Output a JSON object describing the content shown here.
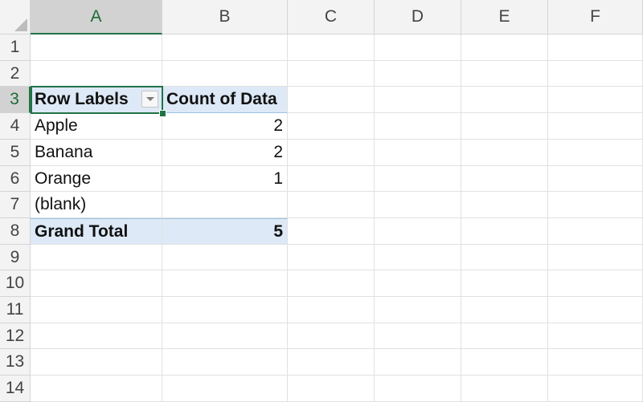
{
  "columns": [
    "A",
    "B",
    "C",
    "D",
    "E",
    "F"
  ],
  "rows": [
    "1",
    "2",
    "3",
    "4",
    "5",
    "6",
    "7",
    "8",
    "9",
    "10",
    "11",
    "12",
    "13",
    "14"
  ],
  "active_cell": "A3",
  "pivot": {
    "header": {
      "row_labels": "Row Labels",
      "value_label": "Count of Data"
    },
    "items": [
      {
        "label": "Apple",
        "count": "2"
      },
      {
        "label": "Banana",
        "count": "2"
      },
      {
        "label": "Orange",
        "count": "1"
      },
      {
        "label": "(blank)",
        "count": ""
      }
    ],
    "grand_total": {
      "label": "Grand Total",
      "count": "5"
    }
  },
  "icons": {
    "filter": "dropdown-arrow-icon",
    "select_all": "select-all-triangle-icon"
  },
  "colors": {
    "accent": "#217346",
    "pivot_band": "#dde9f6",
    "header_bg": "#f3f3f3"
  }
}
